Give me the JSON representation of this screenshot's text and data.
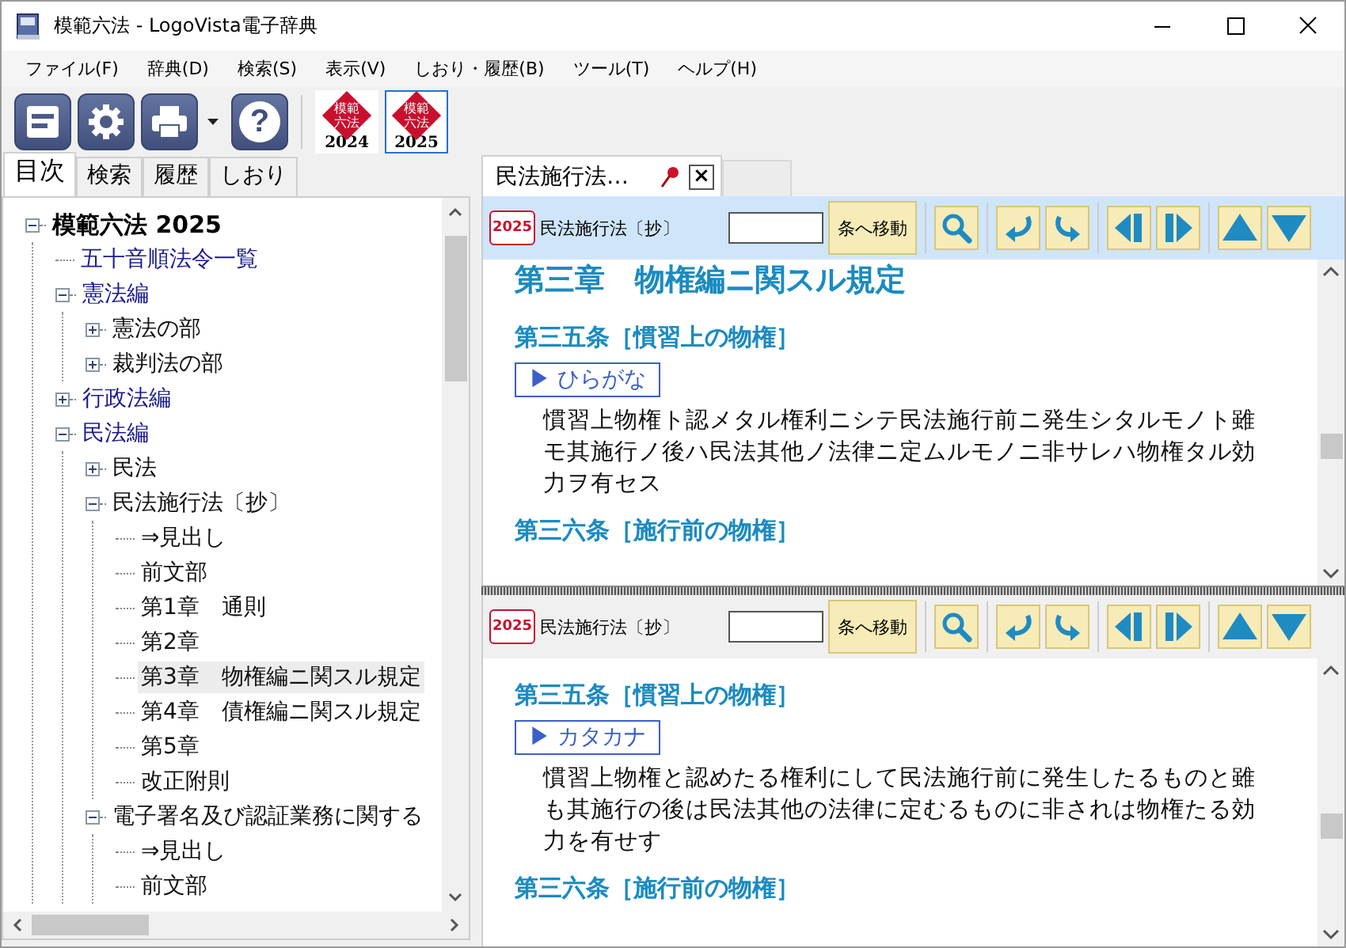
{
  "window": {
    "title": "模範六法 - LogoVista電子辞典"
  },
  "menu": [
    "ファイル(F)",
    "辞典(D)",
    "検索(S)",
    "表示(V)",
    "しおり・履歴(B)",
    "ツール(T)",
    "ヘルプ(H)"
  ],
  "toolbar": {
    "help": "?",
    "editions": [
      {
        "line1": "模範",
        "line2": "六法",
        "year": "2024",
        "selected": false
      },
      {
        "line1": "模範",
        "line2": "六法",
        "year": "2025",
        "selected": true
      }
    ]
  },
  "side_tabs": [
    {
      "label": "目次",
      "selected": true
    },
    {
      "label": "検索",
      "selected": false
    },
    {
      "label": "履歴",
      "selected": false
    },
    {
      "label": "しおり",
      "selected": false
    }
  ],
  "tree": [
    {
      "label": "模範六法 2025",
      "kind": "root",
      "expanded": true,
      "selected": false,
      "children": [
        {
          "label": "五十音順法令一覧",
          "kind": "section",
          "selected": false
        },
        {
          "label": "憲法編",
          "kind": "section",
          "expanded": true,
          "selected": false,
          "children": [
            {
              "label": "憲法の部",
              "kind": "item",
              "expanded": false,
              "selected": false
            },
            {
              "label": "裁判法の部",
              "kind": "item",
              "expanded": false,
              "selected": false
            }
          ]
        },
        {
          "label": "行政法編",
          "kind": "section",
          "expanded": false,
          "selected": false
        },
        {
          "label": "民法編",
          "kind": "section",
          "expanded": true,
          "selected": false,
          "children": [
            {
              "label": "民法",
              "kind": "item",
              "expanded": false,
              "selected": false
            },
            {
              "label": "民法施行法〔抄〕",
              "kind": "item",
              "expanded": true,
              "selected": false,
              "children": [
                {
                  "label": "⇒見出し",
                  "kind": "item",
                  "selected": false
                },
                {
                  "label": "前文部",
                  "kind": "item",
                  "selected": false
                },
                {
                  "label": "第1章　通則",
                  "kind": "item",
                  "selected": false
                },
                {
                  "label": "第2章",
                  "kind": "item",
                  "selected": false
                },
                {
                  "label": "第3章　物権編ニ関スル規定",
                  "kind": "item",
                  "selected": true
                },
                {
                  "label": "第4章　債権編ニ関スル規定",
                  "kind": "item",
                  "selected": false
                },
                {
                  "label": "第5章",
                  "kind": "item",
                  "selected": false
                },
                {
                  "label": "改正附則",
                  "kind": "item",
                  "selected": false
                }
              ]
            },
            {
              "label": "電子署名及び認証業務に関する",
              "kind": "item",
              "expanded": true,
              "selected": false,
              "children": [
                {
                  "label": "⇒見出し",
                  "kind": "item",
                  "selected": false
                },
                {
                  "label": "前文部",
                  "kind": "item",
                  "selected": false
                }
              ]
            }
          ]
        }
      ]
    }
  ],
  "doc_tab": {
    "label": "民法施行法…",
    "close": "×"
  },
  "panes": [
    {
      "active": true,
      "badge": "2025",
      "title": "民法施行法〔抄〕",
      "jump_button": "条へ移動",
      "chapter": "第三章　物権編ニ関スル規定",
      "article": "第三五条［慣習上の物権］",
      "toggle": "▶ ひらがな",
      "text": "慣習上物権ト認メタル権利ニシテ民法施行前ニ発生シタルモノト雖モ其施行ノ後ハ民法其他ノ法律ニ定ムルモノニ非サレハ物権タル効力ヲ有セス",
      "next_article": "第三六条［施行前の物権］"
    },
    {
      "active": false,
      "badge": "2025",
      "title": "民法施行法〔抄〕",
      "jump_button": "条へ移動",
      "article": "第三五条［慣習上の物権］",
      "toggle": "▶ カタカナ",
      "text": "慣習上物権と認めたる権利にして民法施行前に発生したるものと雖も其施行の後は民法其他の法律に定むるものに非されは物権たる効力を有せす",
      "next_article": "第三六条［施行前の物権］"
    }
  ]
}
